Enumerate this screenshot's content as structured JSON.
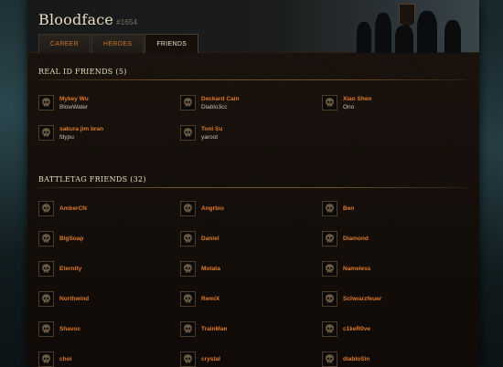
{
  "profile": {
    "name": "Bloodface",
    "tag": "#1654"
  },
  "tabs": [
    {
      "label": "CAREER",
      "active": false
    },
    {
      "label": "HEROES",
      "active": false
    },
    {
      "label": "FRIENDS",
      "active": true
    }
  ],
  "real_id": {
    "title": "REAL ID FRIENDS (5)",
    "friends": [
      {
        "name": "Mykey Wu",
        "sub": "BlowWater"
      },
      {
        "name": "Deckard Cain",
        "sub": "Diablo3cc"
      },
      {
        "name": "Xiao Shen",
        "sub": "Ono"
      },
      {
        "name": "sakura jim bran",
        "sub": "fdypu"
      },
      {
        "name": "Toni Su",
        "sub": "yaroot"
      }
    ]
  },
  "battletag": {
    "title": "BATTLETAG FRIENDS (32)",
    "friends": [
      {
        "name": "AmberCN"
      },
      {
        "name": "Angrbio"
      },
      {
        "name": "Ben"
      },
      {
        "name": "BigSoap"
      },
      {
        "name": "Daniel"
      },
      {
        "name": "Diamond"
      },
      {
        "name": "Eternity"
      },
      {
        "name": "Motata"
      },
      {
        "name": "Nameless"
      },
      {
        "name": "Northwind"
      },
      {
        "name": "RemiX"
      },
      {
        "name": "Schwarzfeuer"
      },
      {
        "name": "Shavoc"
      },
      {
        "name": "TrainMan"
      },
      {
        "name": "c1keR0ve"
      },
      {
        "name": "choi"
      },
      {
        "name": "crystal"
      },
      {
        "name": "diabloSin"
      }
    ]
  },
  "colors": {
    "accent": "#e07a2a",
    "heading": "#e8dcc0",
    "subtext": "#c8c0b0"
  },
  "icons": {
    "portrait": "skull-icon"
  }
}
